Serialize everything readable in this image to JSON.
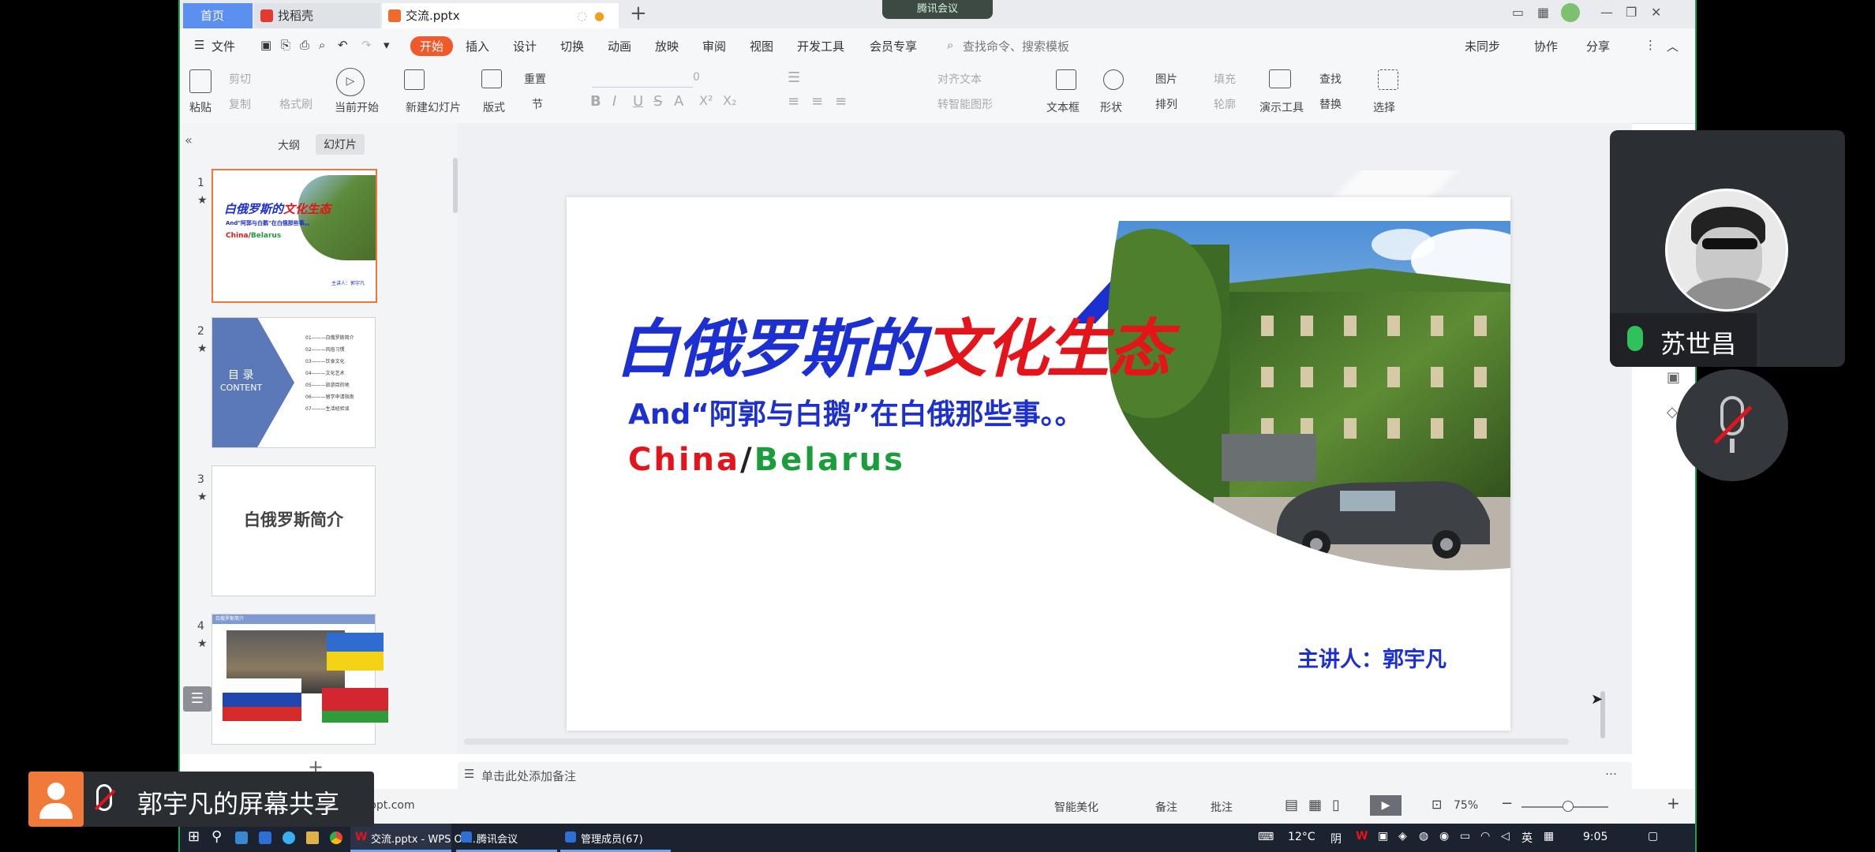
{
  "tabs": {
    "home": "首页",
    "find": "找稻壳",
    "file": "交流.pptx"
  },
  "meeting_pill": "腾讯会议",
  "menu": {
    "file": "文件",
    "start": "开始",
    "insert": "插入",
    "design": "设计",
    "transition": "切换",
    "animation": "动画",
    "show": "放映",
    "review": "审阅",
    "view": "视图",
    "dev": "开发工具",
    "member": "会员专享",
    "search": "查找命令、搜索模板",
    "sync": "未同步",
    "collab": "协作",
    "share": "分享"
  },
  "ribbon": {
    "cut": "剪切",
    "copy": "复制",
    "format_painter": "格式刷",
    "paste": "粘贴",
    "from_current": "当前开始",
    "new_slide": "新建幻灯片",
    "layout": "版式",
    "section": "节",
    "reset": "重置",
    "font_size": "0",
    "align_text": "对齐文本",
    "convert_smart": "转智能图形",
    "textbox": "文本框",
    "shape": "形状",
    "picture": "图片",
    "arrange": "排列",
    "fill": "填充",
    "outline": "轮廓",
    "present_tool": "演示工具",
    "find": "查找",
    "replace": "替换",
    "select": "选择"
  },
  "panel_tabs": {
    "outline": "大纲",
    "slides": "幻灯片"
  },
  "thumbs": {
    "t1": {
      "num": "1",
      "title_a": "白俄罗斯的",
      "title_b": "文化生态",
      "sub": "And\"阿郭与白鹅\"在白俄那些事。。",
      "cb_a": "China",
      "cb_b": "Belarus",
      "speaker": "主讲人：郭宇凡"
    },
    "t2": {
      "num": "2",
      "toc": "目 录",
      "content": "CONTENT",
      "items": [
        "01———白俄罗斯简介",
        "02———风俗习惯",
        "03———饮食文化",
        "04———文化艺术",
        "05———旅游目的地",
        "06———留学申请指南",
        "07———生活经验谈"
      ]
    },
    "t3": {
      "num": "3",
      "title": "白俄罗斯简介"
    },
    "t4": {
      "num": "4",
      "header": "白俄罗斯简介"
    }
  },
  "slide": {
    "title_a": "白俄罗斯的",
    "title_b": "文化生态",
    "subtitle": "And“阿郭与白鹅”在白俄那些事。。",
    "cb_china": "China",
    "cb_slash": "/",
    "cb_belarus": "Belarus",
    "speaker": "主讲人：郭宇凡"
  },
  "notes_placeholder": "单击此处添加备注",
  "status": {
    "site": "ppt.com",
    "beautify": "智能美化",
    "notes": "备注",
    "comment": "批注",
    "zoom": "75%"
  },
  "taskbar": {
    "wps": "交流.pptx - WPS Off...",
    "meeting": "腾讯会议",
    "members": "管理成员(67)",
    "temp": "12°C",
    "weather": "阴",
    "lang": "英",
    "time": "9:05"
  },
  "participant": {
    "name": "苏世昌"
  },
  "share_banner": "郭宇凡的屏幕共享",
  "colors": {
    "ribbon_accent": "#f05a2a",
    "meeting_green": "#1aa34a",
    "slide_title_blue": "#1c2fd0",
    "slide_title_red": "#e3141a",
    "belarus_green": "#1a9d3a"
  }
}
